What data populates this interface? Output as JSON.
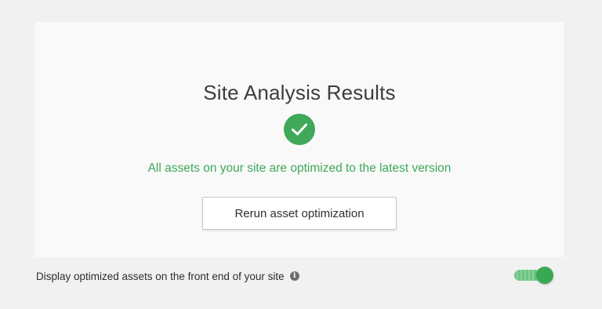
{
  "card": {
    "title": "Site Analysis Results",
    "status_icon": "check-circle-icon",
    "status_text": "All assets on your site are optimized to the latest version",
    "rerun_button_label": "Rerun asset optimization"
  },
  "setting": {
    "label": "Display optimized assets on the front end of your site",
    "info_icon": "info-icon",
    "info_glyph": "i",
    "toggle_on": true
  },
  "colors": {
    "accent_green": "#3fa859",
    "background": "#f1f1f1",
    "card_background": "#f9f9f9"
  }
}
